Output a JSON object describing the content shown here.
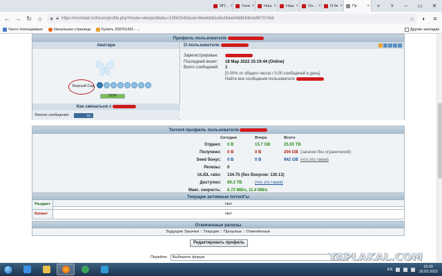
{
  "browser": {
    "tabs": [
      {
        "label": "ЯП..."
      },
      {
        "label": "Гели"
      },
      {
        "label": "Наш"
      },
      {
        "label": "Наш"
      },
      {
        "label": "Он..."
      },
      {
        "label": "Я бе"
      },
      {
        "label": "Пр",
        "active": true
      }
    ],
    "url": "https://mnmdub.to/forum/profile.php?mode=viewprofile&u=13562045&sid=56eebb61e5e2b4a048d940b2ef6f737#bit",
    "bookmarks": [
      {
        "label": "Часто посещаемые"
      },
      {
        "label": "Начальная страница"
      },
      {
        "label": "Купить 339701431 - ..."
      }
    ],
    "bookmarks_right": "Другие закладки"
  },
  "profile": {
    "header": "Профиль пользователя",
    "avatar_header": "Аватара",
    "info_header": "О пользователе",
    "rank": "Верный Сид",
    "rank_progress": 1.0,
    "rank_progress_text": "100%",
    "contact_header": "Как связаться с",
    "pm_label": "Личное сообщение:",
    "pm_button": "ЛС",
    "registered_label": "Зарегистрирован:",
    "last_visit_label": "Последний визит:",
    "last_visit_value": "18 Мар 2022 15:19:44 (Online)",
    "total_posts_label": "Всего сообщений:",
    "total_posts_value": "1",
    "posts_share": "[0.00% от общего числа / 0.00 сообщений в день]",
    "find_posts": "Найти все сообщения пользователя"
  },
  "torrent": {
    "header": "Torrent-профиль пользователя",
    "col_today": "Сегодня",
    "col_yesterday": "Вчера",
    "col_total": "Всего",
    "rows": [
      {
        "label": "Отдано:",
        "today": "0 B",
        "yesterday": "15.7 GB",
        "total": "25.93 TB",
        "color": "green"
      },
      {
        "label": "Получено:",
        "today": "0 B",
        "yesterday": "0 B",
        "total": "204 GB",
        "color": "red",
        "note": "(закачки без ограничений)"
      },
      {
        "label": "Seed бонус:",
        "today": "0 B",
        "yesterday": "0 B",
        "total": "942 GB",
        "color": "blue",
        "note": "(что это такое)"
      },
      {
        "label": "Релизы:",
        "today": "0"
      }
    ],
    "ratio_label": "UL/DL ratio:",
    "ratio_value": "134.75  (без бонусов: 130.13)",
    "available_label": "Доступно:",
    "available_value": "89.3 TB",
    "available_note": "(что это такое)",
    "max_speed_label": "Макс. скорость:",
    "max_speed_value": "6.72 MB/s, 11.4 MB/s"
  },
  "active": {
    "header": "Текущие активные torrent'ы",
    "seeding_label": "Раздает",
    "seeding_value": "Нет",
    "leeching_label": "Качает",
    "leeching_value": "Нет"
  },
  "releases": {
    "header": "Отмеченные релизы",
    "links": "Будущие Закачки :: Текущие :: Прошлые :: Отменённые"
  },
  "edit_button": "Редактировать профиль",
  "goto_label": "Перейти:",
  "goto_select": "Выберите форум",
  "watermark": "YAPLAKAL.COM",
  "taskbar": {
    "lang": "EN",
    "time": "15:20",
    "date": "18.03.2022"
  },
  "colors": {
    "head_bg": "#a8bccd",
    "row_bg": "#eff3f6",
    "uploaded": "#2a8a12",
    "downloaded": "#b51a12",
    "bonus": "#1c4fa0",
    "annotation": "#c0151a"
  }
}
